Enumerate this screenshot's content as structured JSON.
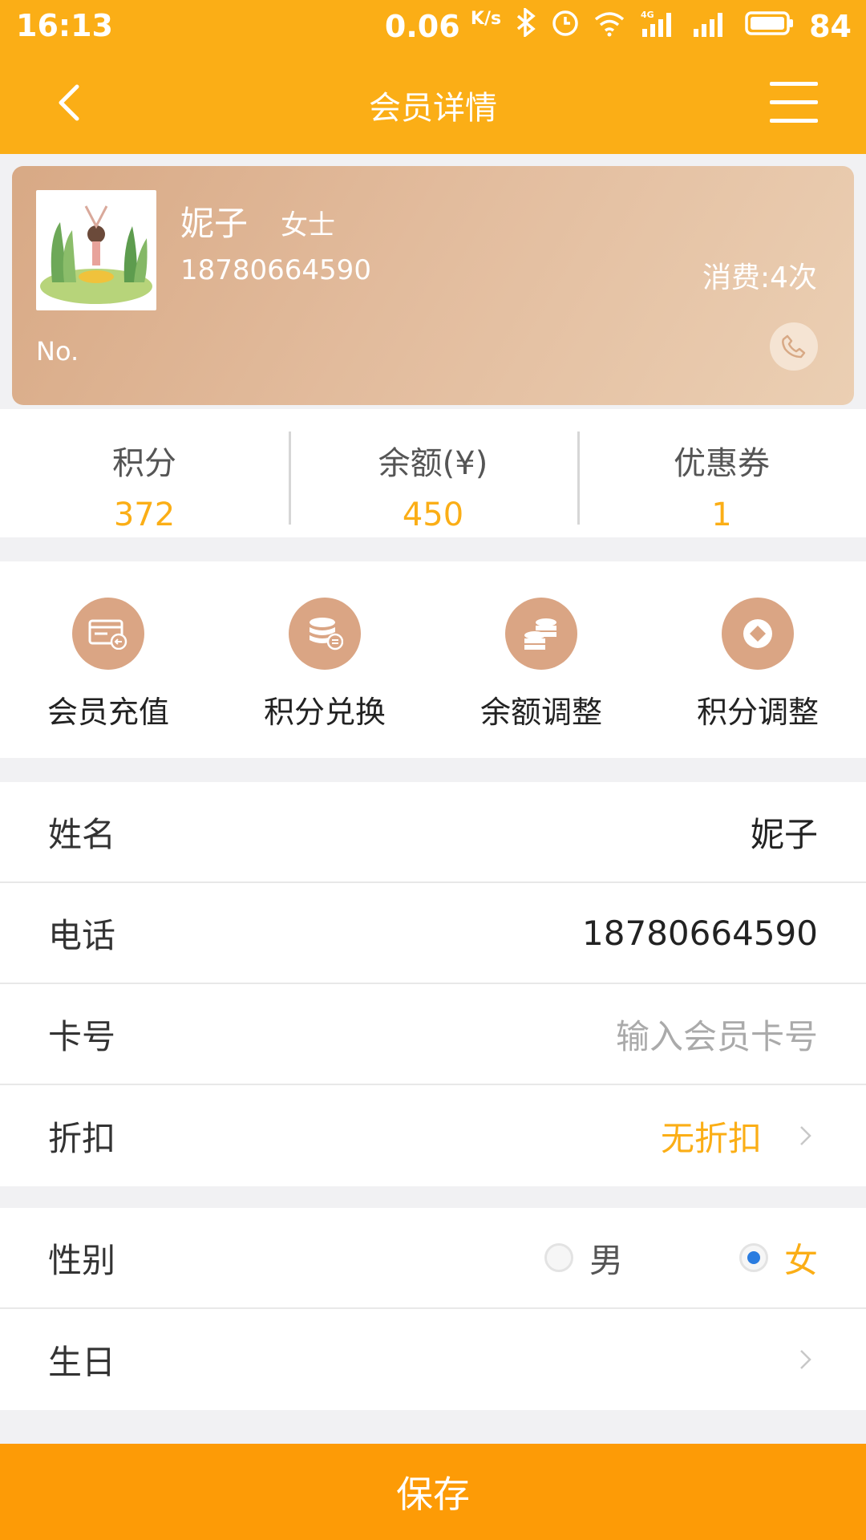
{
  "statusbar": {
    "time": "16:13",
    "speed": "0.06",
    "speed_unit": "K/s",
    "battery": "84"
  },
  "navbar": {
    "title": "会员详情"
  },
  "card": {
    "name": "妮子",
    "title_tag": "女士",
    "phone": "18780664590",
    "consume": "消费:4次",
    "card_no": "No."
  },
  "stats": [
    {
      "label": "积分",
      "value": "372"
    },
    {
      "label": "余额(¥)",
      "value": "450"
    },
    {
      "label": "优惠券",
      "value": "1"
    }
  ],
  "actions": [
    {
      "label": "会员充值",
      "icon": "card-recharge-icon"
    },
    {
      "label": "积分兑换",
      "icon": "coin-exchange-icon"
    },
    {
      "label": "余额调整",
      "icon": "coins-stack-icon"
    },
    {
      "label": "积分调整",
      "icon": "diamond-icon"
    }
  ],
  "form": {
    "name": {
      "label": "姓名",
      "value": "妮子"
    },
    "phone": {
      "label": "电话",
      "value": "18780664590"
    },
    "card_no": {
      "label": "卡号",
      "placeholder": "输入会员卡号"
    },
    "discount": {
      "label": "折扣",
      "value": "无折扣"
    },
    "gender": {
      "label": "性别",
      "options": [
        "男",
        "女"
      ],
      "selected": "女"
    },
    "birthday": {
      "label": "生日",
      "value": ""
    }
  },
  "save_button": {
    "label": "保存"
  },
  "colors": {
    "primary": "#fbae16",
    "save": "#fd9b06",
    "card": "#daa584",
    "radio": "#2a7ce0"
  }
}
